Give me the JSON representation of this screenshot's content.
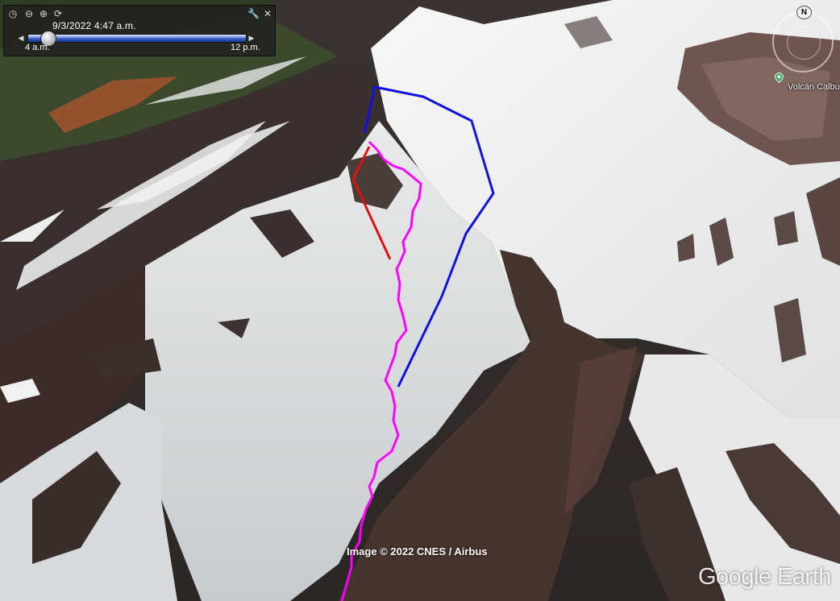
{
  "timeline": {
    "date_time": "9/3/2022   4:47 a.m.",
    "start_label": "4 a.m.",
    "end_label": "12 p.m.",
    "position": 0.06
  },
  "toolbar": {
    "icons": [
      "clock-icon",
      "zoom-out-icon",
      "zoom-in-icon",
      "refresh-icon",
      "wrench-icon",
      "close-icon"
    ]
  },
  "navigation": {
    "north_label": "N"
  },
  "place": {
    "label": "Volcán Calbuco",
    "icon": "place-pin-icon",
    "color": "#3fb76a"
  },
  "attribution": {
    "credit": "Image © 2022 CNES / Airbus",
    "logo": "Google Earth"
  },
  "overlays": {
    "route_color": "#ff00ff",
    "polygon_color": "#1010e0",
    "segment_color": "#e01010"
  }
}
